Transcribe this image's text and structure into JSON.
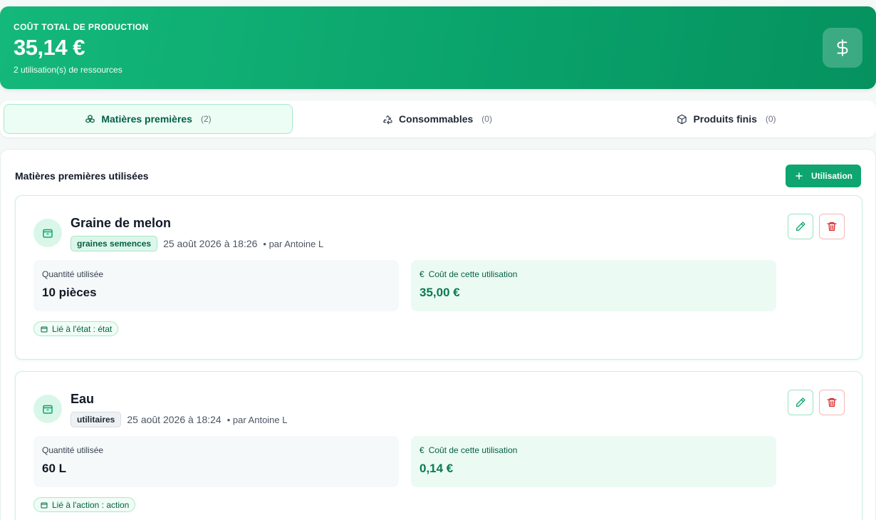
{
  "summary": {
    "label": "COÛT TOTAL DE PRODUCTION",
    "total": "35,14 €",
    "subtitle": "2 utilisation(s) de ressources",
    "icon": "dollar-icon"
  },
  "tabs": [
    {
      "label": "Matières premières",
      "count": "(2)",
      "icon": "cubes-icon",
      "active": true
    },
    {
      "label": "Consommables",
      "count": "(0)",
      "icon": "recycle-icon",
      "active": false
    },
    {
      "label": "Produits finis",
      "count": "(0)",
      "icon": "box-icon",
      "active": false
    }
  ],
  "panel": {
    "title": "Matières premières utilisées",
    "add_label": "Utilisation"
  },
  "labels": {
    "quantity": "Quantité utilisée",
    "cost": "Coût de cette utilisation",
    "euro": "€"
  },
  "items": [
    {
      "name": "Graine de melon",
      "category": "graines semences",
      "date": "25 août 2026 à 18:26",
      "by": "• par Antoine L",
      "quantity": "10 pièces",
      "cost": "35,00 €",
      "link": "Lié à l'état : état"
    },
    {
      "name": "Eau",
      "category": "utilitaires",
      "date": "25 août 2026 à 18:24",
      "by": "• par Antoine L",
      "quantity": "60 L",
      "cost": "0,14 €",
      "link": "Lié à l'action : action"
    }
  ],
  "colors": {
    "accent": "#0ea570",
    "danger": "#dc2626"
  }
}
